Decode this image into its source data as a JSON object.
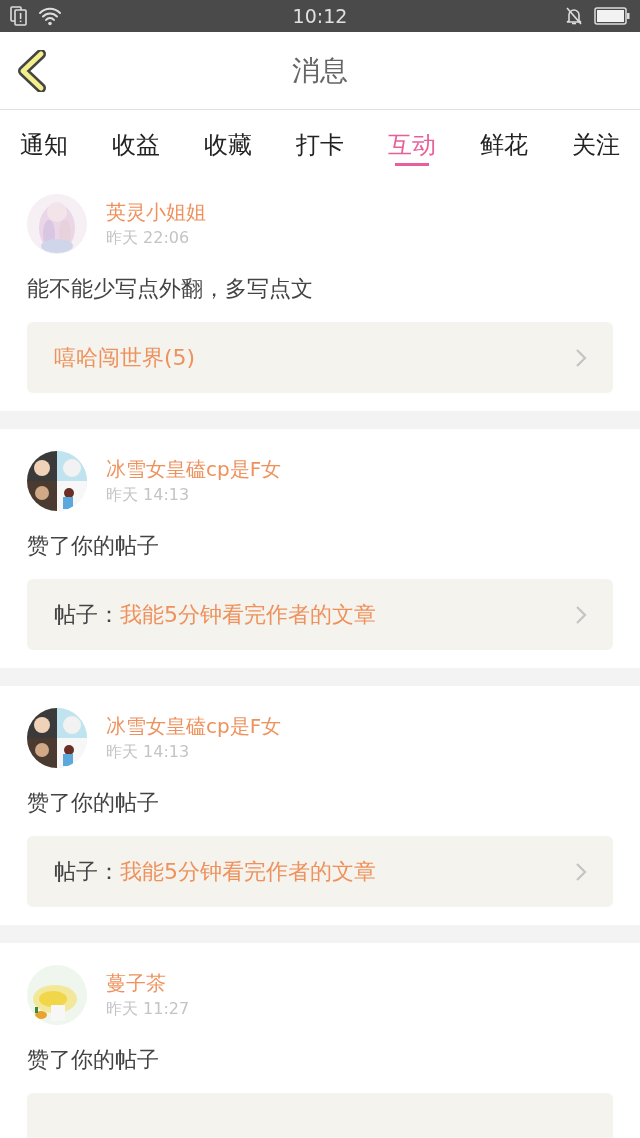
{
  "status_bar": {
    "time": "10:12"
  },
  "header": {
    "title": "消息"
  },
  "tabs": [
    {
      "label": "通知",
      "selected": false
    },
    {
      "label": "收益",
      "selected": false
    },
    {
      "label": "收藏",
      "selected": false
    },
    {
      "label": "打卡",
      "selected": false
    },
    {
      "label": "互动",
      "selected": true
    },
    {
      "label": "鲜花",
      "selected": false
    },
    {
      "label": "关注",
      "selected": false
    }
  ],
  "messages": [
    {
      "user": "英灵小姐姐",
      "time": "昨天 22:06",
      "text": "能不能少写点外翻，多写点文",
      "link": {
        "kind": "group",
        "title": "嘻哈闯世界(5)"
      }
    },
    {
      "user": "冰雪女皇磕cp是F女",
      "time": "昨天 14:13",
      "text": "赞了你的帖子",
      "link": {
        "kind": "post",
        "label": "帖子：",
        "title": "我能5分钟看完作者的文章"
      }
    },
    {
      "user": "冰雪女皇磕cp是F女",
      "time": "昨天 14:13",
      "text": "赞了你的帖子",
      "link": {
        "kind": "post",
        "label": "帖子：",
        "title": "我能5分钟看完作者的文章"
      }
    },
    {
      "user": "蔓子茶",
      "time": "昨天 11:27",
      "text": "赞了你的帖子",
      "link": {
        "kind": "blank"
      }
    }
  ]
}
